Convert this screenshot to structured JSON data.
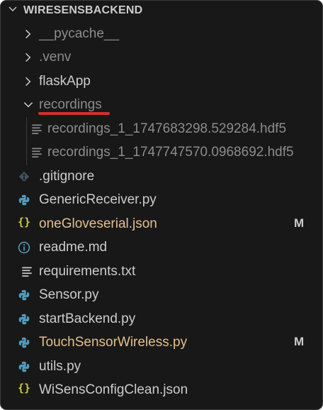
{
  "explorer": {
    "root": "WIRESENSBACKEND"
  },
  "items": [
    {
      "label": "__pycache__",
      "type": "folder",
      "expanded": false,
      "badge": ""
    },
    {
      "label": ".venv",
      "type": "folder",
      "expanded": false,
      "badge": ""
    },
    {
      "label": "flaskApp",
      "type": "folder",
      "expanded": false,
      "badge": ""
    },
    {
      "label": "recordings",
      "type": "folder",
      "expanded": true,
      "badge": ""
    },
    {
      "label": "recordings_1_1747683298.529284.hdf5",
      "type": "file",
      "icon": "lines-icon",
      "badge": ""
    },
    {
      "label": "recordings_1_1747747570.0968692.hdf5",
      "type": "file",
      "icon": "lines-icon",
      "badge": ""
    },
    {
      "label": ".gitignore",
      "type": "file",
      "icon": "git-icon",
      "badge": ""
    },
    {
      "label": "GenericReceiver.py",
      "type": "file",
      "icon": "python-icon",
      "badge": ""
    },
    {
      "label": "oneGloveserial.json",
      "type": "file",
      "icon": "json-icon",
      "badge": "M"
    },
    {
      "label": "readme.md",
      "type": "file",
      "icon": "info-icon",
      "badge": ""
    },
    {
      "label": "requirements.txt",
      "type": "file",
      "icon": "lines-icon",
      "badge": ""
    },
    {
      "label": "Sensor.py",
      "type": "file",
      "icon": "python-icon",
      "badge": ""
    },
    {
      "label": "startBackend.py",
      "type": "file",
      "icon": "python-icon",
      "badge": ""
    },
    {
      "label": "TouchSensorWireless.py",
      "type": "file",
      "icon": "python-icon",
      "badge": "M"
    },
    {
      "label": "utils.py",
      "type": "file",
      "icon": "python-icon",
      "badge": ""
    },
    {
      "label": "WiSensConfigClean.json",
      "type": "file",
      "icon": "json-icon",
      "badge": ""
    }
  ],
  "colors": {
    "background": "#181818",
    "text": "#cccccc",
    "ignored_text": "#8c8c8c",
    "modified_text": "#e2c08d",
    "python_icon": "#519aba",
    "json_icon": "#cbcb41",
    "annotation_underline": "#d32f2f"
  }
}
